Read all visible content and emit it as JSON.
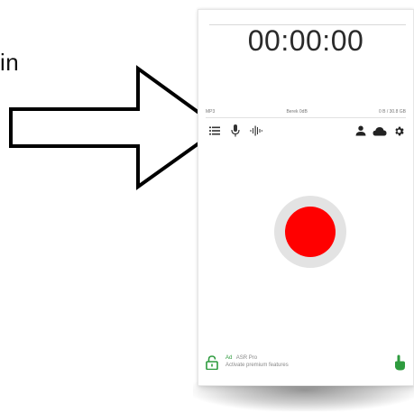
{
  "annotation": {
    "cropped_word": "in"
  },
  "recorder": {
    "timer": "00:00:00",
    "format": "MP3",
    "gain": "Berek 0dB",
    "storage": "0 B / 30.8 GB"
  },
  "toolbar": {
    "left_icons": [
      "list-icon",
      "microphone-icon",
      "waveform-icon"
    ],
    "right_icons": [
      "person-icon",
      "cloud-icon",
      "gear-icon"
    ]
  },
  "record_button": {
    "color": "#ff0000",
    "ring_color": "#e3e3e3"
  },
  "ad": {
    "badge": "Ad",
    "title": "ASR Pro",
    "subtitle": "Activate premium features",
    "accent": "#2e9b3e"
  }
}
